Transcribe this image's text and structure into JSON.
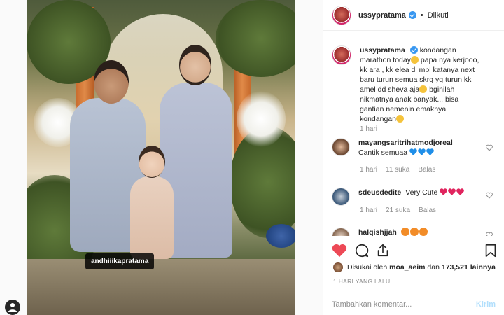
{
  "header": {
    "username": "ussypratama",
    "follow_status": "Diikuti",
    "separator": "•"
  },
  "photo": {
    "tag_label": "andhiiikapratama",
    "user_tag_icon": "person-icon"
  },
  "caption": {
    "username": "ussypratama",
    "text_part1": "kondangan marathon today",
    "text_part2": " papa nya kerjooo, kk ara , kk elea di mbl katanya next baru turun semua skrg yg turun kk amel dd sheva aja",
    "text_part3": " bginilah nikmatnya anak banyak... bisa gantian nemenin emaknya kondangan",
    "time": "1 hari"
  },
  "comments": [
    {
      "username": "mayangsaritrihatmodjoreal",
      "text": "Cantik semuaa",
      "emoji": [
        "blue-heart",
        "blue-heart",
        "blue-heart"
      ],
      "time": "1 hari",
      "likes": "11 suka",
      "reply": "Balas"
    },
    {
      "username": "sdeusdedite",
      "text": "Very Cute",
      "emoji": [
        "red-heart",
        "red-heart",
        "red-heart"
      ],
      "time": "1 hari",
      "likes": "21 suka",
      "reply": "Balas"
    },
    {
      "username": "halqishjjah",
      "text": "",
      "emoji": [
        "heart-eyes",
        "heart-eyes",
        "heart-eyes"
      ]
    }
  ],
  "actions": {
    "like_icon": "heart-filled-icon",
    "comment_icon": "comment-bubble-icon",
    "share_icon": "share-icon",
    "save_icon": "bookmark-icon",
    "like_color": "#ed4956"
  },
  "likes": {
    "prefix": "Disukai oleh",
    "first_user": "moa_aeim",
    "connector": "dan",
    "count": "173,521",
    "suffix": "lainnya"
  },
  "date_label": "1 HARI YANG LALU",
  "composer": {
    "placeholder": "Tambahkan komentar...",
    "send_label": "Kirim"
  },
  "colors": {
    "verified": "#3897f0",
    "muted": "#8e8e8e",
    "send_disabled": "#b2dffc"
  }
}
